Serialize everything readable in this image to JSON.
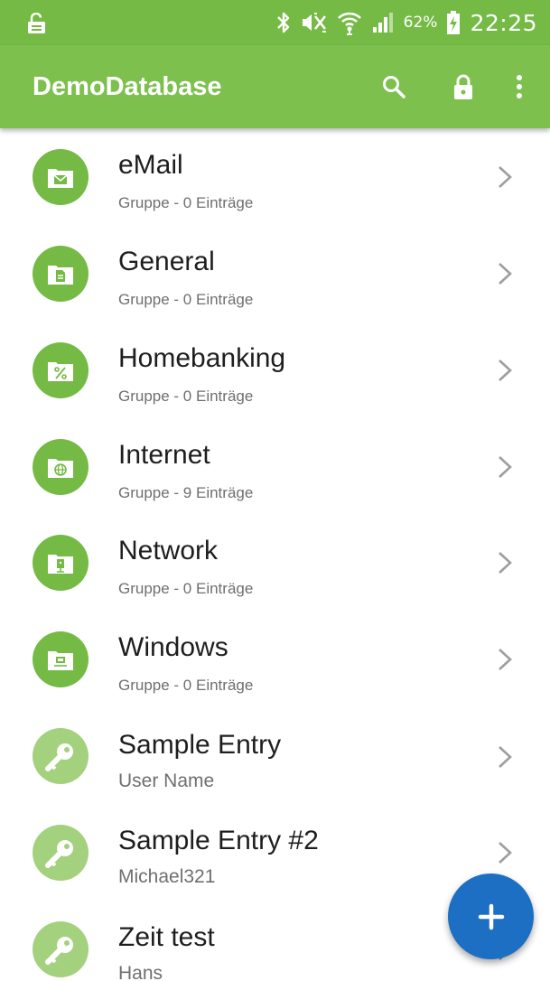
{
  "status_bar": {
    "battery_percent": "62%",
    "time": "22:25"
  },
  "app_bar": {
    "title": "DemoDatabase",
    "actions": [
      "search-icon",
      "lock-icon",
      "more-vertical-icon"
    ]
  },
  "colors": {
    "status_bar": "#74ba45",
    "app_bar": "#7dc04e",
    "group_avatar": "#74ba45",
    "entry_avatar": "#a3d17e",
    "fab": "#1d6fc4"
  },
  "list": {
    "items": [
      {
        "title": "eMail",
        "subtitle": "Gruppe - 0 Einträge",
        "icon": "mail-folder-icon"
      },
      {
        "title": "General",
        "subtitle": "Gruppe - 0 Einträge",
        "icon": "document-folder-icon"
      },
      {
        "title": "Homebanking",
        "subtitle": "Gruppe - 0 Einträge",
        "icon": "percent-folder-icon"
      },
      {
        "title": "Internet",
        "subtitle": "Gruppe - 9 Einträge",
        "icon": "globe-folder-icon"
      },
      {
        "title": "Network",
        "subtitle": "Gruppe - 0 Einträge",
        "icon": "network-folder-icon"
      },
      {
        "title": "Windows",
        "subtitle": "Gruppe - 0 Einträge",
        "icon": "windows-folder-icon"
      },
      {
        "title": "Sample Entry",
        "subtitle": "User Name",
        "icon": "key-icon"
      },
      {
        "title": "Sample Entry #2",
        "subtitle": "Michael321",
        "icon": "key-icon"
      },
      {
        "title": "Zeit test",
        "subtitle": "Hans",
        "icon": "key-icon"
      }
    ]
  },
  "fab": {
    "icon": "plus-icon"
  }
}
